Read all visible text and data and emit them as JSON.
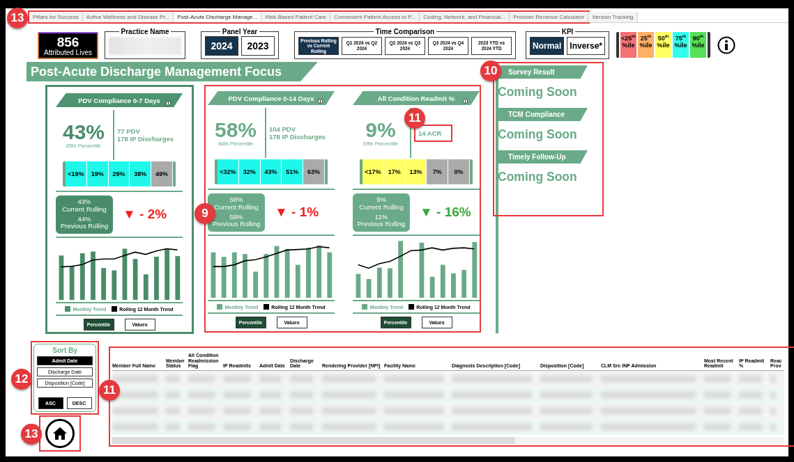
{
  "tab_groups": [
    {
      "callout": "13",
      "tabs": [
        {
          "label": "Pillars for Success",
          "selected": false
        },
        {
          "label": "Active Wellness and Disease Pr...",
          "selected": false
        },
        {
          "label": "Post-Acute Discharge Manage...",
          "selected": true
        },
        {
          "label": "Risk-Based Patient Care",
          "selected": false
        },
        {
          "label": "Convenient Patient Access to P...",
          "selected": false
        },
        {
          "label": "Coding, Network, and Financial...",
          "selected": false
        },
        {
          "label": "Provider Revenue Calculator",
          "selected": false
        }
      ]
    },
    {
      "tabs": [
        {
          "label": "Version Tracking",
          "selected": false
        }
      ]
    }
  ],
  "header": {
    "lives": {
      "value": "856",
      "label": "Attributed Lives"
    },
    "practice": {
      "title": "Practice Name"
    },
    "panel_year": {
      "title": "Panel Year",
      "options": [
        {
          "label": "2024",
          "selected": true
        },
        {
          "label": "2023",
          "selected": false
        }
      ]
    },
    "time_comparison": {
      "title": "Time Comparison",
      "options": [
        {
          "label": "Previous Rolling vs Current Rolling",
          "selected": true
        },
        {
          "label": "Q1 2024 vs Q2 2024",
          "selected": false
        },
        {
          "label": "Q2 2024 vs Q3 2024",
          "selected": false
        },
        {
          "label": "Q3 2024 vs Q4 2024",
          "selected": false
        },
        {
          "label": "2023 YTD vs 2024 YTD",
          "selected": false
        }
      ]
    },
    "kpi": {
      "title": "KPI",
      "options": [
        {
          "label": "Normal",
          "selected": true
        },
        {
          "label": "Inverse*",
          "selected": false
        }
      ]
    },
    "legend": [
      {
        "label": "<25$^{th}$ %ile",
        "color": "#f47174"
      },
      {
        "label": "25$^{th}$ %ile",
        "color": "#ffb066"
      },
      {
        "label": "50$^{th}$ %ile",
        "color": "#ffff66"
      },
      {
        "label": "75$^{th}$ %ile",
        "color": "#33ffee"
      },
      {
        "label": "90$^{th}$ %ile",
        "color": "#55e055"
      }
    ]
  },
  "section_title": "Post-Acute Discharge Management Focus",
  "metric_group_callout": "9",
  "cards": [
    {
      "selected": true,
      "title": "PDV Compliance 0-7 Days",
      "value": "43%",
      "percentile": "85th Percentile",
      "details": [
        {
          "text": "77 PDV"
        },
        {
          "text": "178 IP Discharges"
        }
      ],
      "scale": [
        {
          "label": "<19%",
          "color": "#1ff7ea"
        },
        {
          "label": "19%",
          "color": "#1ff7ea"
        },
        {
          "label": "29%",
          "color": "#1ff7ea"
        },
        {
          "label": "38%",
          "color": "#1ff7ea"
        },
        {
          "label": "49%",
          "color": "#aaaaaa"
        }
      ],
      "current": {
        "value": "43%",
        "label": "Current Rolling"
      },
      "previous": {
        "value": "44%",
        "label": "Previous Rolling"
      },
      "change": {
        "arrow": "▼",
        "text": "- 2%",
        "favorable": false
      },
      "legend": [
        "Monthly Trend",
        "Rolling 12 Month Trend"
      ],
      "toggles": [
        {
          "label": "Percentile",
          "selected": true
        },
        {
          "label": "Values",
          "selected": false
        }
      ]
    },
    {
      "selected": false,
      "title": "PDV Compliance 0-14 Days",
      "value": "58%",
      "percentile": "86th Percentile",
      "details": [
        {
          "text": "104 PDV"
        },
        {
          "text": "178 IP Discharges"
        }
      ],
      "scale": [
        {
          "label": "<32%",
          "color": "#1ff7ea"
        },
        {
          "label": "32%",
          "color": "#1ff7ea"
        },
        {
          "label": "43%",
          "color": "#1ff7ea"
        },
        {
          "label": "51%",
          "color": "#1ff7ea"
        },
        {
          "label": "63%",
          "color": "#aaaaaa"
        }
      ],
      "current": {
        "value": "58%",
        "label": "Current Rolling"
      },
      "previous": {
        "value": "59%",
        "label": "Previous Rolling"
      },
      "change": {
        "arrow": "▼",
        "text": "- 1%",
        "favorable": false
      },
      "legend": [
        "Monthly Trend",
        "Rolling 12 Month Trend"
      ],
      "toggles": [
        {
          "label": "Percentile",
          "selected": true
        },
        {
          "label": "Values",
          "selected": false
        }
      ]
    },
    {
      "selected": false,
      "title": "All Condition Readmit %",
      "value": "9%",
      "percentile": "69th Percentile",
      "details": [
        {
          "text": "14 ACR",
          "callout": "11"
        }
      ],
      "scale": [
        {
          "label": "<17%",
          "color": "#ffff66"
        },
        {
          "label": "17%",
          "color": "#ffff66"
        },
        {
          "label": "13%",
          "color": "#ffff66"
        },
        {
          "label": "7%",
          "color": "#aaaaaa"
        },
        {
          "label": "0%",
          "color": "#aaaaaa"
        }
      ],
      "current": {
        "value": "9%",
        "label": "Current Rolling"
      },
      "previous": {
        "value": "11%",
        "label": "Previous Rolling"
      },
      "change": {
        "arrow": "▼",
        "text": "- 16%",
        "favorable": true
      },
      "legend": [
        "Monthly Trend",
        "Rolling 12 Month Trend"
      ],
      "toggles": [
        {
          "label": "Percentile",
          "selected": true
        },
        {
          "label": "Values",
          "selected": false
        }
      ]
    }
  ],
  "side_panel": {
    "callout": "10",
    "sections": [
      {
        "title": "Survey Result",
        "body": "Coming Soon"
      },
      {
        "title": "TCM Compliance",
        "body": "Coming Soon"
      },
      {
        "title": "Timely Follow-Up",
        "body": "Coming Soon"
      }
    ]
  },
  "sort_panel": {
    "callout": "12",
    "title": "Sort By",
    "options": [
      {
        "label": "Admit Date",
        "selected": true
      },
      {
        "label": "Discharge Date",
        "selected": false
      },
      {
        "label": "Disposition [Code]",
        "selected": false
      }
    ],
    "order": [
      {
        "label": "ASC",
        "selected": true
      },
      {
        "label": "DESC",
        "selected": false
      }
    ]
  },
  "home": {
    "callout": "13"
  },
  "table": {
    "callout": "11",
    "columns": [
      "Member Full Name",
      "Member Status",
      "All Condition Readmission Flag",
      "IP Readmits",
      "Admit Date",
      "Discharge Date",
      "Rendering Provider [NPI]",
      "Facility Name",
      "Diagnosis Description [Code]",
      "Disposition [Code]",
      "CLM Src INP Admission",
      "Most Recent Readmit",
      "IP Readmit %",
      "Reac Prov"
    ]
  }
}
